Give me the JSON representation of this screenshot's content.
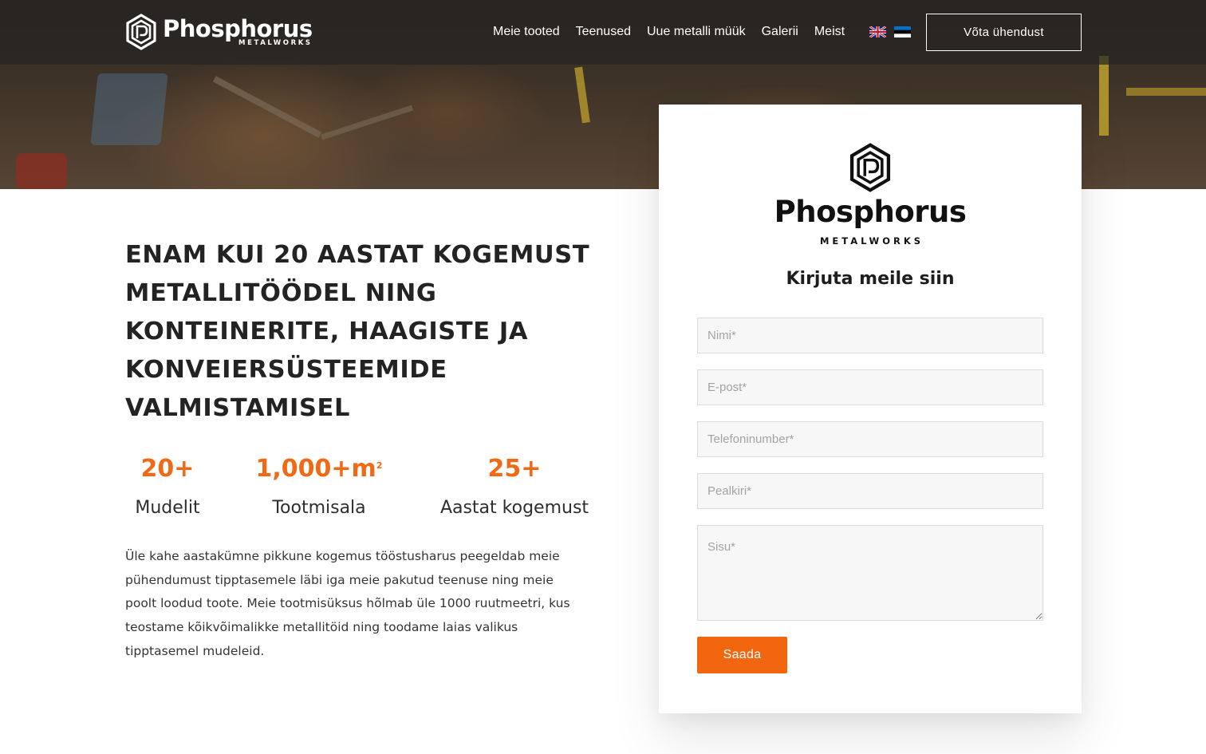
{
  "brand": {
    "name": "Phosphorus",
    "sub": "METALWORKS"
  },
  "nav": {
    "items": [
      "Meie tooted",
      "Teenused",
      "Uue metalli müük",
      "Galerii",
      "Meist"
    ],
    "languages": [
      "English",
      "Eesti"
    ],
    "contact_label": "Võta ühendust"
  },
  "hero": {
    "headline": "Enam kui 20 aastat kogemust metallitöödel ning konteinerite, haagiste ja konveiersüsteemide valmistamisel",
    "stats": [
      {
        "value": "20+",
        "unit": "",
        "label": "Mudelit"
      },
      {
        "value": "1,000+m",
        "unit": "2",
        "label": "Tootmisala"
      },
      {
        "value": "25+",
        "unit": "",
        "label": "Aastat kogemust"
      }
    ],
    "paragraph": "Üle kahe aastakümne pikkune kogemus tööstusharus peegeldab meie pühendumust tipptasemele läbi iga meie pakutud teenuse ning meie poolt loodud toote. Meie tootmisüksus hõlmab üle 1000 ruutmeetri, kus teostame kõikvõimalikke metallitöid ning toodame laias valikus tipptasemel mudeleid."
  },
  "form": {
    "title": "Kirjuta meile siin",
    "name_placeholder": "Nimi*",
    "email_placeholder": "E-post*",
    "phone_placeholder": "Telefoninumber*",
    "subject_placeholder": "Pealkiri*",
    "message_placeholder": "Sisu*",
    "submit_label": "Saada"
  },
  "colors": {
    "accent": "#f2660f",
    "stat_number": "#f06a16",
    "header_bg": "#262422"
  },
  "icons": [
    "phosphorus-logo-icon",
    "uk-flag-icon",
    "estonia-flag-icon"
  ]
}
